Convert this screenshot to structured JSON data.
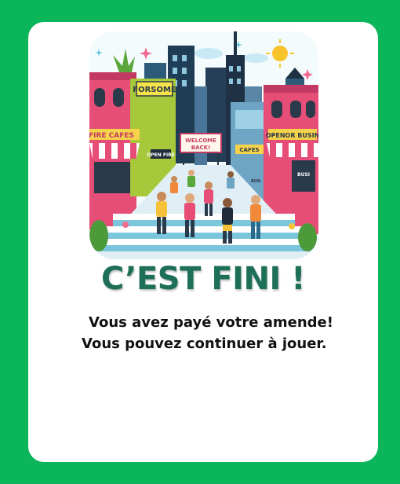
{
  "dialog": {
    "title": "C’EST FINI !",
    "message_line1": "Vous avez payé votre amende!",
    "message_line2": "Vous pouvez continuer à jouer."
  },
  "illustration": {
    "signs": {
      "storefront_left": "FORSOME",
      "cafe_left": "FIRE CAFES",
      "open_sign": "OPEN FIRE",
      "banner_line1": "WELCOME",
      "banner_line2": "BACK!",
      "cafe_right": "CAFES",
      "storefront_right": "OPENOR BUSIN",
      "window_right": "BUSI",
      "window_right_small": "BUN"
    }
  },
  "colors": {
    "background": "#0bb55a",
    "card": "#ffffff",
    "title": "#1e6f57",
    "text": "#111111"
  }
}
